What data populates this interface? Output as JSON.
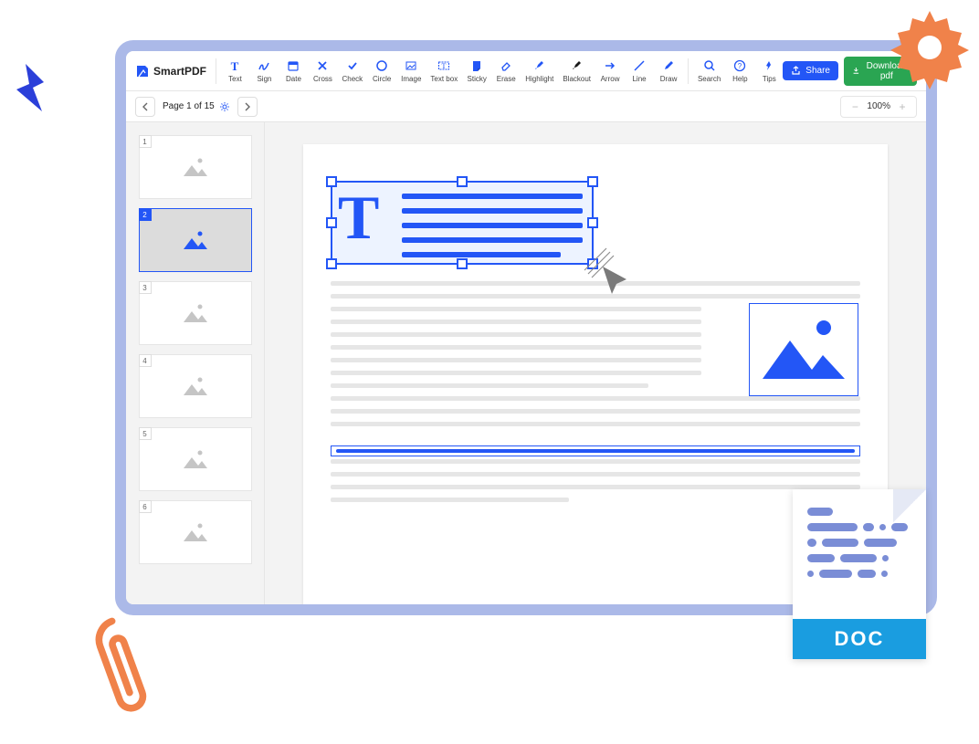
{
  "brand": {
    "name": "SmartPDF"
  },
  "tools": [
    {
      "id": "text",
      "label": "Text"
    },
    {
      "id": "sign",
      "label": "Sign"
    },
    {
      "id": "date",
      "label": "Date"
    },
    {
      "id": "cross",
      "label": "Cross"
    },
    {
      "id": "check",
      "label": "Check"
    },
    {
      "id": "circle",
      "label": "Circle"
    },
    {
      "id": "image",
      "label": "Image"
    },
    {
      "id": "textbox",
      "label": "Text box"
    },
    {
      "id": "sticky",
      "label": "Sticky"
    },
    {
      "id": "erase",
      "label": "Erase"
    },
    {
      "id": "highlight",
      "label": "Highlight"
    },
    {
      "id": "blackout",
      "label": "Blackout"
    },
    {
      "id": "arrow",
      "label": "Arrow"
    },
    {
      "id": "line",
      "label": "Line"
    },
    {
      "id": "draw",
      "label": "Draw"
    }
  ],
  "help_tools": [
    {
      "id": "search",
      "label": "Search"
    },
    {
      "id": "help",
      "label": "Help"
    },
    {
      "id": "tips",
      "label": "Tips"
    }
  ],
  "actions": {
    "share": "Share",
    "download": "Download pdf"
  },
  "pagination": {
    "label": "Page 1 of 15",
    "current_page": 1,
    "total_pages": 15
  },
  "zoom": {
    "value": "100%"
  },
  "thumbnails": [
    {
      "num": "1",
      "active": false
    },
    {
      "num": "2",
      "active": true
    },
    {
      "num": "3",
      "active": false
    },
    {
      "num": "4",
      "active": false
    },
    {
      "num": "5",
      "active": false
    },
    {
      "num": "6",
      "active": false
    }
  ],
  "doc_badge": {
    "label": "DOC"
  }
}
